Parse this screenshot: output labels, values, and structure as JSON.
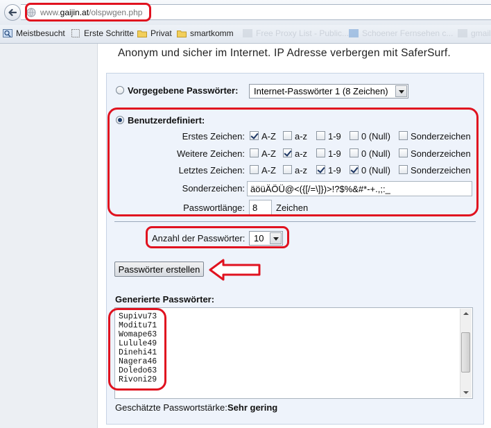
{
  "browser": {
    "url_prefix": "www.",
    "url_domain": "gaijin.at",
    "url_path": "/olspwgen.php",
    "bookmarks": [
      "Meistbesucht",
      "Erste Schritte",
      "Privat",
      "smartkomm",
      "Free Proxy List - Public...",
      "Schoener Fernsehen c...",
      "gmail"
    ]
  },
  "page": {
    "headline": "Anonym und sicher im Internet. IP Adresse verbergen mit SaferSurf."
  },
  "predefined": {
    "label": "Vorgegebene Passwörter:",
    "selected": false,
    "select_value": "Internet-Passwörter 1 (8 Zeichen)"
  },
  "custom": {
    "label": "Benutzerdefiniert:",
    "selected": true,
    "option_labels": [
      "A-Z",
      "a-z",
      "1-9",
      "0 (Null)",
      "Sonderzeichen"
    ],
    "rows": [
      {
        "label": "Erstes Zeichen:",
        "checks": [
          true,
          false,
          false,
          false,
          false
        ]
      },
      {
        "label": "Weitere Zeichen:",
        "checks": [
          false,
          true,
          false,
          false,
          false
        ]
      },
      {
        "label": "Letztes Zeichen:",
        "checks": [
          false,
          false,
          true,
          true,
          false
        ]
      }
    ],
    "special_label": "Sonderzeichen:",
    "special_value": "äöüÄÖÜ@<({[/=\\]})>!?$%&#*-+.,;:_",
    "length_label": "Passwortlänge:",
    "length_value": "8",
    "length_unit": "Zeichen"
  },
  "count": {
    "label": "Anzahl der Passwörter:",
    "value": "10"
  },
  "create_button": "Passwörter erstellen",
  "generated": {
    "heading": "Generierte Passwörter:",
    "passwords": [
      "Supivu73",
      "Moditu71",
      "Womape63",
      "Lulule49",
      "Dinehi41",
      "Nagera46",
      "Doledo63",
      "Rivoni29"
    ]
  },
  "strength": {
    "label": "Geschätzte Passwortstärke:",
    "value": "Sehr gering"
  },
  "colors": {
    "annotation": "#e0121f",
    "panel_bg": "#eef3fb"
  }
}
